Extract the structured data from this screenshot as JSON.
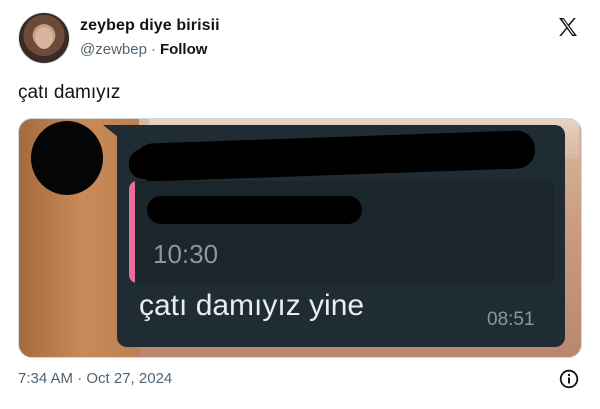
{
  "author": {
    "display_name": "zeybep diye birisii",
    "handle": "@zewbep",
    "separator": "·",
    "follow_label": "Follow"
  },
  "tweet": {
    "text": "çatı damıyız"
  },
  "media": {
    "quoted_time": "10:30",
    "message_text": "çatı damıyız yine",
    "message_time": "08:51",
    "accent_color": "#ec6f9a",
    "bubble_color": "#1f2c33"
  },
  "meta": {
    "timestamp": "7:34 AM · Oct 27, 2024"
  },
  "icons": {
    "brand": "x-logo-icon",
    "info": "info-icon"
  }
}
